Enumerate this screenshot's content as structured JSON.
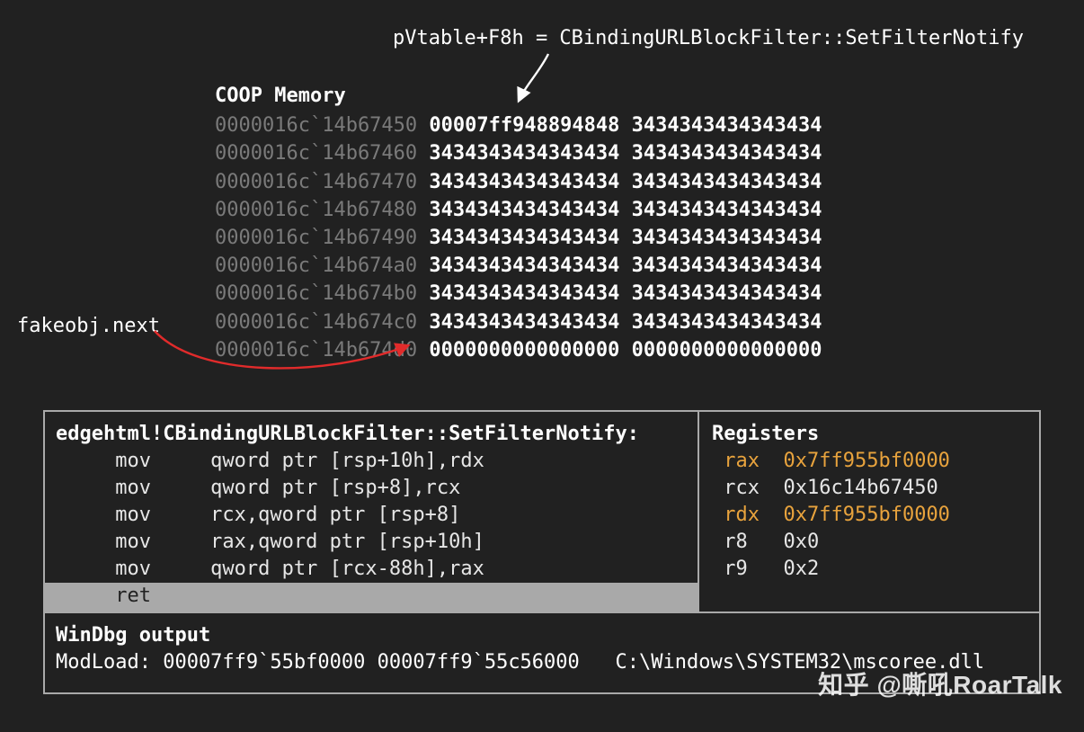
{
  "annotation_top": "pVtable+F8h = CBindingURLBlockFilter::SetFilterNotify",
  "annotation_left": "fakeobj.next",
  "memory": {
    "title": "COOP Memory",
    "rows": [
      {
        "addr": "0000016c`14b67450",
        "v1": "00007ff948894848",
        "v2": "3434343434343434"
      },
      {
        "addr": "0000016c`14b67460",
        "v1": "3434343434343434",
        "v2": "3434343434343434"
      },
      {
        "addr": "0000016c`14b67470",
        "v1": "3434343434343434",
        "v2": "3434343434343434"
      },
      {
        "addr": "0000016c`14b67480",
        "v1": "3434343434343434",
        "v2": "3434343434343434"
      },
      {
        "addr": "0000016c`14b67490",
        "v1": "3434343434343434",
        "v2": "3434343434343434"
      },
      {
        "addr": "0000016c`14b674a0",
        "v1": "3434343434343434",
        "v2": "3434343434343434"
      },
      {
        "addr": "0000016c`14b674b0",
        "v1": "3434343434343434",
        "v2": "3434343434343434"
      },
      {
        "addr": "0000016c`14b674c0",
        "v1": "3434343434343434",
        "v2": "3434343434343434"
      },
      {
        "addr": "0000016c`14b674d0",
        "v1": "0000000000000000",
        "v2": "0000000000000000"
      }
    ]
  },
  "asm": {
    "title": "edgehtml!CBindingURLBlockFilter::SetFilterNotify:",
    "lines": [
      "     mov     qword ptr [rsp+10h],rdx",
      "     mov     qword ptr [rsp+8],rcx",
      "     mov     rcx,qword ptr [rsp+8]",
      "     mov     rax,qword ptr [rsp+10h]",
      "     mov     qword ptr [rcx-88h],rax"
    ],
    "ret": "     ret"
  },
  "registers": {
    "title": "Registers",
    "rows": [
      {
        "name": "rax",
        "val": "0x7ff955bf0000",
        "hl": true
      },
      {
        "name": "rcx",
        "val": "0x16c14b67450",
        "hl": false
      },
      {
        "name": "rdx",
        "val": "0x7ff955bf0000",
        "hl": true
      },
      {
        "name": "r8",
        "val": "0x0",
        "hl": false
      },
      {
        "name": "r9",
        "val": "0x2",
        "hl": false
      }
    ]
  },
  "windbg": {
    "title": "WinDbg output",
    "line": "ModLoad: 00007ff9`55bf0000 00007ff9`55c56000   C:\\Windows\\SYSTEM32\\mscoree.dll"
  },
  "watermark": "知乎 @嘶吼RoarTalk"
}
